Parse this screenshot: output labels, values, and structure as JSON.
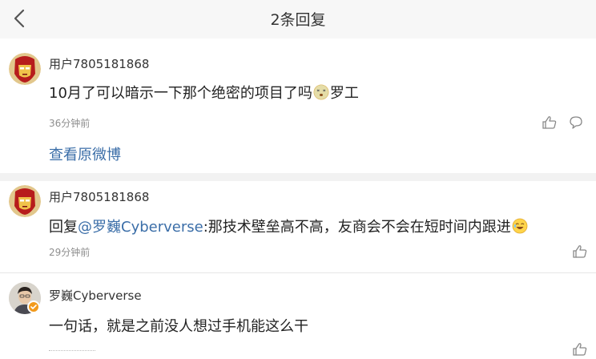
{
  "header": {
    "title": "2条回复"
  },
  "original": {
    "username": "用户7805181868",
    "content_text": "10月了可以暗示一下那个绝密的项目了吗",
    "content_suffix": "罗工",
    "time": "36分钟前",
    "view_original": "查看原微博"
  },
  "replies": [
    {
      "username": "用户7805181868",
      "prefix": "回复",
      "mention": "@罗巍Cyberverse",
      "text": ":那技术壁垒高不高，友商会不会在短时间内跟进",
      "time": "29分钟前"
    },
    {
      "username": "罗巍Cyberverse",
      "text": "一句话，就是之前没人想过手机能这么干"
    }
  ],
  "colors": {
    "link": "#3b6ea8",
    "separator": "#f2f2f2",
    "badge": "#f29a1c",
    "meta": "#8e8e8e"
  },
  "icons": [
    "back-arrow-icon",
    "like-icon",
    "comment-icon",
    "ironman-avatar",
    "user-avatar",
    "verified-badge-icon",
    "dizzy-emoji",
    "laugh-emoji"
  ]
}
